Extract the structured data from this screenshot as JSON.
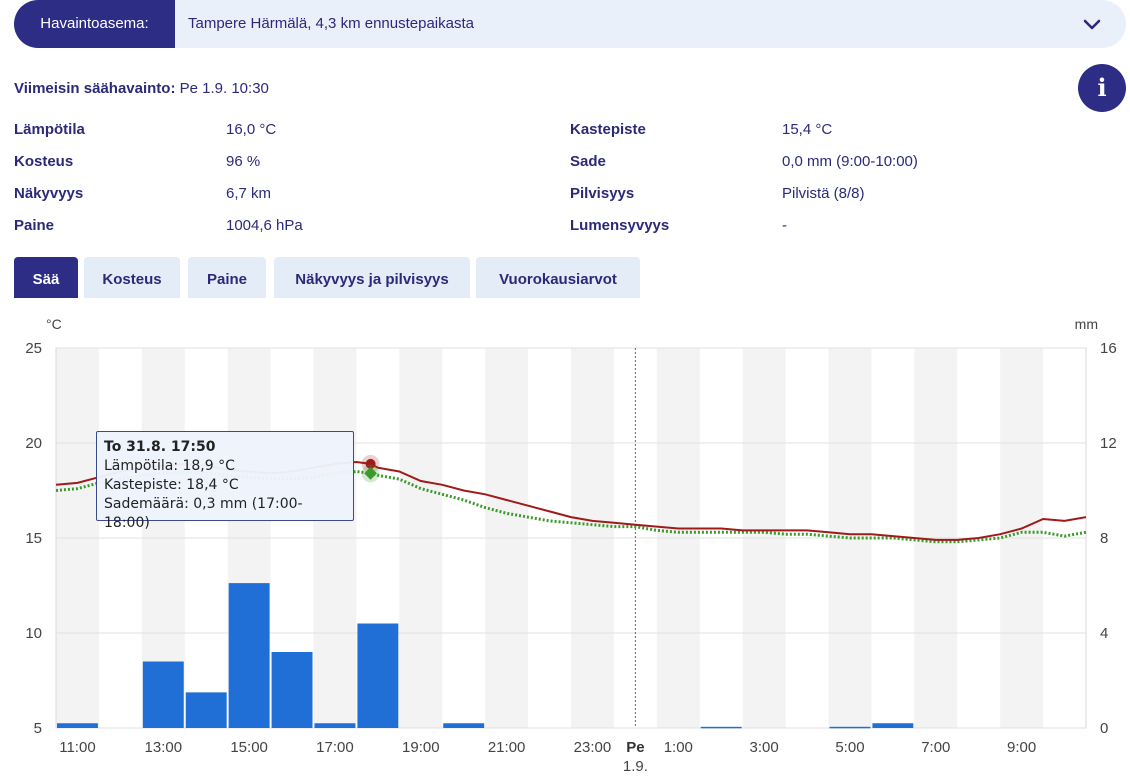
{
  "station": {
    "label": "Havaintoasema:",
    "value": "Tampere Härmälä, 4,3 km ennustepaikasta"
  },
  "latest": {
    "label": "Viimeisin säähavainto:",
    "value": "Pe 1.9. 10:30"
  },
  "info_button": "i",
  "observations": [
    {
      "label": "Lämpötila",
      "value": "16,0 °C"
    },
    {
      "label": "Kosteus",
      "value": "96 %"
    },
    {
      "label": "Näkyvyys",
      "value": "6,7 km"
    },
    {
      "label": "Paine",
      "value": "1004,6 hPa"
    },
    {
      "label": "Kastepiste",
      "value": "15,4 °C"
    },
    {
      "label": "Sade",
      "value": "0,0 mm (9:00-10:00)"
    },
    {
      "label": "Pilvisyys",
      "value": "Pilvistä (8/8)"
    },
    {
      "label": "Lumensyvyys",
      "value": "-"
    }
  ],
  "tabs": [
    "Sää",
    "Kosteus",
    "Paine",
    "Näkyvyys ja pilvisyys",
    "Vuorokausiarvot"
  ],
  "colors": {
    "temperature": "#a01a1a",
    "dewpoint": "#3a9a2a",
    "precipitation": "#1f6fd6",
    "accent": "#2d2d86"
  },
  "tooltip": {
    "title": "To 31.8. 17:50",
    "line1": "Lämpötila: 18,9 °C",
    "line2": "Kastepiste: 18,4 °C",
    "line3": "Sademäärä: 0,3 mm (17:00-18:00)"
  },
  "chart_data": {
    "type": "line",
    "y_left_label": "°C",
    "y_right_label": "mm",
    "ylim_left": [
      5,
      25
    ],
    "ylim_right": [
      0,
      16
    ],
    "left_ticks": [
      "25",
      "20",
      "15",
      "10",
      "5"
    ],
    "right_ticks": [
      "16",
      "12",
      "8",
      "4",
      "0"
    ],
    "x_range": [
      10.5,
      34.5
    ],
    "x_ticks": [
      {
        "x": 11,
        "label": "11:00"
      },
      {
        "x": 13,
        "label": "13:00"
      },
      {
        "x": 15,
        "label": "15:00"
      },
      {
        "x": 17,
        "label": "17:00"
      },
      {
        "x": 19,
        "label": "19:00"
      },
      {
        "x": 21,
        "label": "21:00"
      },
      {
        "x": 23,
        "label": "23:00"
      },
      {
        "x": 25,
        "label": "1:00"
      },
      {
        "x": 27,
        "label": "3:00"
      },
      {
        "x": 29,
        "label": "5:00"
      },
      {
        "x": 31,
        "label": "7:00"
      },
      {
        "x": 33,
        "label": "9:00"
      }
    ],
    "day_marker": {
      "x": 24,
      "label": "Pe",
      "sublabel": "1.9."
    },
    "series": [
      {
        "name": "Lämpötila",
        "x": [
          10.5,
          11,
          11.5,
          12,
          12.5,
          13,
          13.5,
          14,
          14.5,
          15,
          15.5,
          16,
          16.5,
          17,
          17.5,
          17.83,
          18,
          18.5,
          19,
          19.5,
          20,
          20.5,
          21,
          21.5,
          22,
          22.5,
          23,
          23.5,
          24,
          24.5,
          25,
          25.5,
          26,
          26.5,
          27,
          27.5,
          28,
          28.5,
          29,
          29.5,
          30,
          30.5,
          31,
          31.5,
          32,
          32.5,
          33,
          33.5,
          34,
          34.5
        ],
        "values": [
          17.8,
          17.9,
          18.2,
          18.5,
          18.7,
          18.8,
          18.9,
          18.8,
          18.6,
          18.5,
          18.4,
          18.5,
          18.7,
          18.9,
          19.0,
          18.9,
          18.7,
          18.5,
          18.0,
          17.8,
          17.5,
          17.3,
          17.0,
          16.7,
          16.4,
          16.1,
          15.9,
          15.8,
          15.7,
          15.6,
          15.5,
          15.5,
          15.5,
          15.4,
          15.4,
          15.4,
          15.4,
          15.3,
          15.2,
          15.2,
          15.1,
          15.0,
          14.9,
          14.9,
          15.0,
          15.2,
          15.5,
          16.0,
          15.9,
          16.1
        ]
      },
      {
        "name": "Kastepiste",
        "x": [
          10.5,
          11,
          11.5,
          12,
          12.5,
          13,
          13.5,
          14,
          14.5,
          15,
          15.5,
          16,
          16.5,
          17,
          17.5,
          17.83,
          18,
          18.5,
          19,
          19.5,
          20,
          20.5,
          21,
          21.5,
          22,
          22.5,
          23,
          23.5,
          24,
          24.5,
          25,
          25.5,
          26,
          26.5,
          27,
          27.5,
          28,
          28.5,
          29,
          29.5,
          30,
          30.5,
          31,
          31.5,
          32,
          32.5,
          33,
          33.5,
          34,
          34.5
        ],
        "values": [
          17.5,
          17.6,
          17.9,
          18.1,
          18.3,
          18.4,
          18.5,
          18.4,
          18.3,
          18.2,
          18.1,
          18.1,
          18.2,
          18.4,
          18.5,
          18.4,
          18.3,
          18.1,
          17.6,
          17.3,
          17.0,
          16.6,
          16.3,
          16.1,
          15.9,
          15.8,
          15.7,
          15.6,
          15.6,
          15.4,
          15.3,
          15.3,
          15.3,
          15.3,
          15.3,
          15.2,
          15.2,
          15.1,
          15.0,
          15.0,
          15.0,
          14.9,
          14.8,
          14.8,
          14.9,
          15.0,
          15.3,
          15.3,
          15.1,
          15.3
        ]
      },
      {
        "name": "Sademäärä",
        "type": "bar",
        "x": [
          11,
          12,
          13,
          14,
          15,
          16,
          17,
          18,
          19,
          20,
          21,
          22,
          23,
          24,
          25,
          26,
          27,
          28,
          29,
          30,
          31,
          32,
          33,
          34
        ],
        "values": [
          0.2,
          0,
          2.8,
          1.5,
          6.1,
          3.2,
          0.2,
          4.4,
          0,
          0.2,
          0,
          0,
          0,
          0,
          0,
          0.05,
          0,
          0,
          0.05,
          0.2,
          0,
          0,
          0,
          0
        ]
      }
    ],
    "highlight_x": 17.83
  }
}
